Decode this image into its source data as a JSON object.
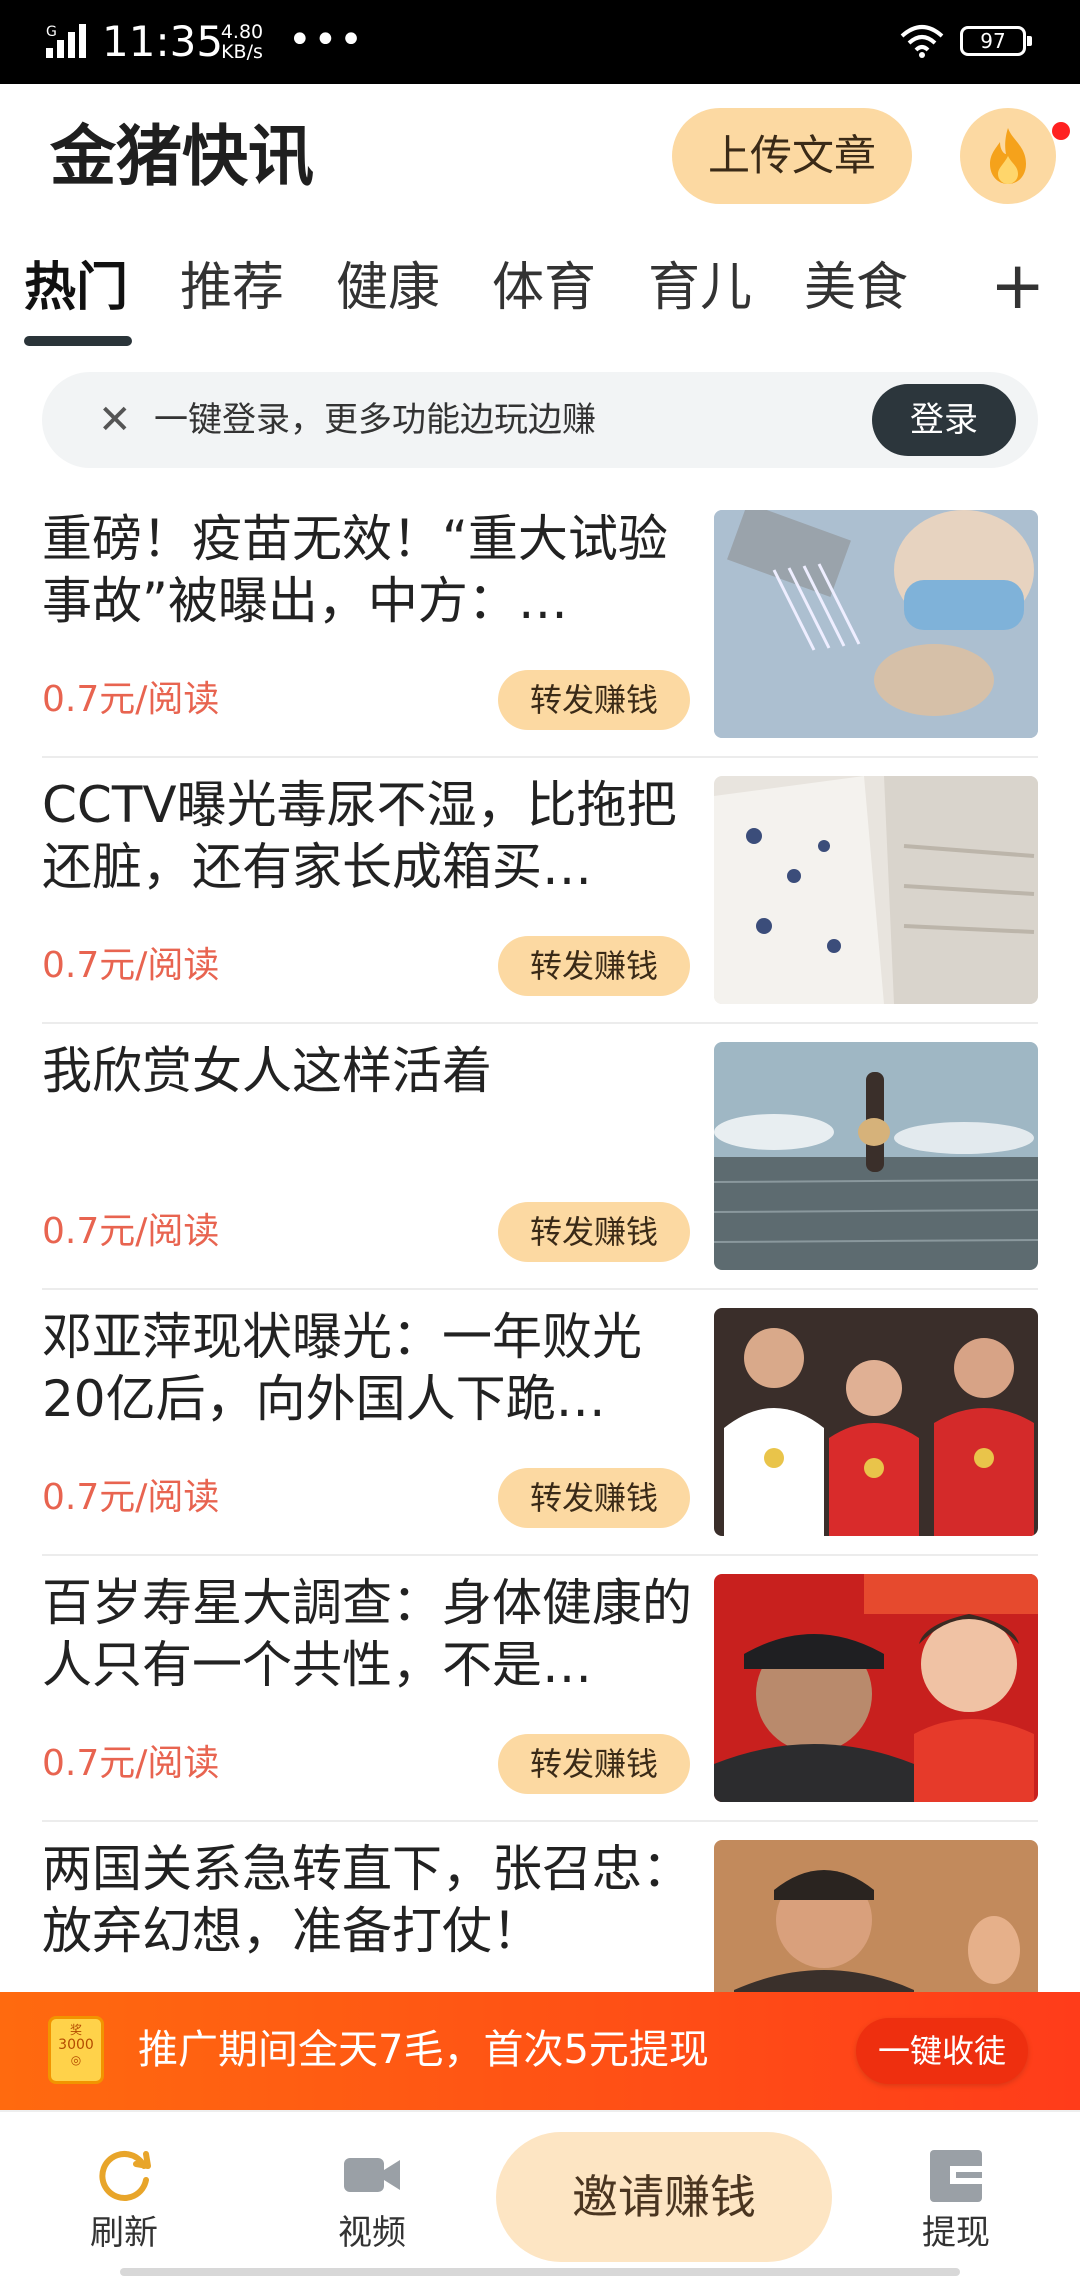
{
  "status_bar": {
    "time": "11:35",
    "speed": "4.80 KB/s",
    "dots": "•••",
    "battery": "97"
  },
  "header": {
    "title": "金猪快讯",
    "upload_label": "上传文章"
  },
  "tabs": [
    {
      "label": "热门",
      "active": true
    },
    {
      "label": "推荐"
    },
    {
      "label": "健康"
    },
    {
      "label": "体育"
    },
    {
      "label": "育儿"
    },
    {
      "label": "美食"
    }
  ],
  "tab_add": "+",
  "login_banner": {
    "close": "✕",
    "text": "一键登录，更多功能边玩边赚",
    "button": "登录"
  },
  "news": [
    {
      "title": "重磅！疫苗无效！“重大试验事故”被曝出，中方：…",
      "price": "0.7元/阅读",
      "share": "转发赚钱"
    },
    {
      "title": "CCTV曝光毒尿不湿，比拖把还脏，还有家长成箱买…",
      "price": "0.7元/阅读",
      "share": "转发赚钱"
    },
    {
      "title": "我欣赏女人这样活着",
      "price": "0.7元/阅读",
      "share": "转发赚钱"
    },
    {
      "title": "邓亚萍现状曝光：一年败光20亿后，向外国人下跪…",
      "price": "0.7元/阅读",
      "share": "转发赚钱"
    },
    {
      "title": "百岁寿星大調查：身体健康的人只有一个共性，不是…",
      "price": "0.7元/阅读",
      "share": "转发赚钱"
    },
    {
      "title": "两国关系急转直下，张召忠：放弃幻想，准备打仗！"
    }
  ],
  "promo": {
    "text": "推广期间全天7毛，首次5元提现",
    "button": "一键收徒"
  },
  "bottom_nav": {
    "refresh": "刷新",
    "video": "视频",
    "invite": "邀请赚钱",
    "withdraw": "提现"
  },
  "colors": {
    "accent_light": "#fcd9a2",
    "price_red": "#e86450",
    "promo_orange": "#ff5a14",
    "dark_button": "#2c363c"
  }
}
